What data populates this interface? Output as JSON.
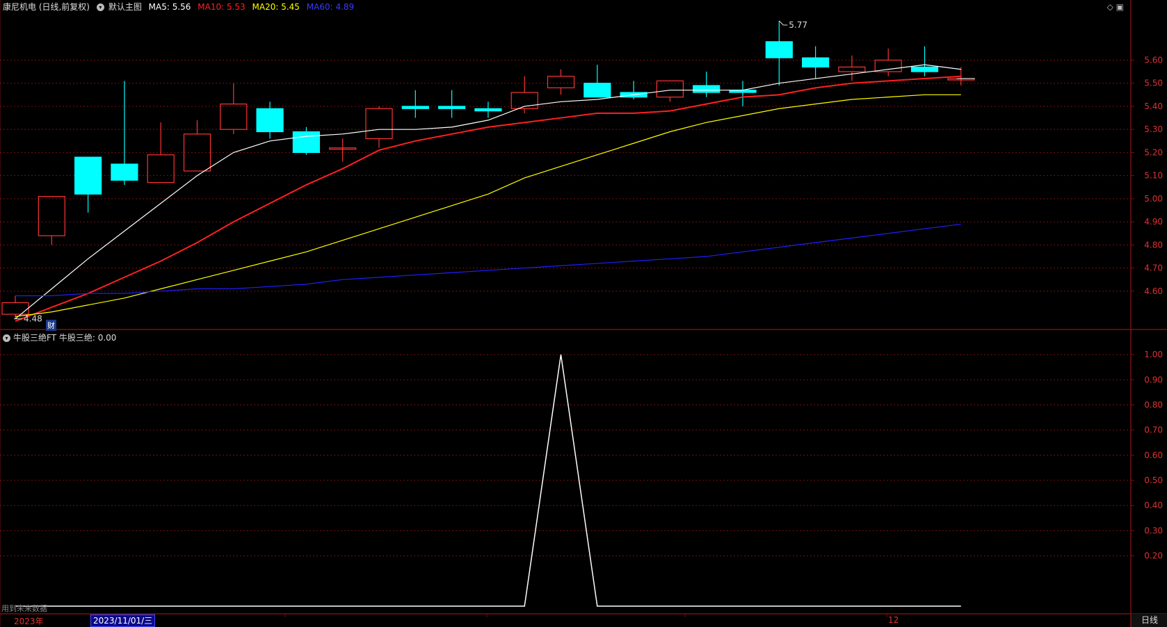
{
  "header": {
    "stock_title": "康尼机电 (日线,前复权)",
    "main_chart": "默认主图",
    "ma5": {
      "label": "MA5: 5.56",
      "color": "#ffffff"
    },
    "ma10": {
      "label": "MA10: 5.53",
      "color": "#ff2020"
    },
    "ma20": {
      "label": "MA20: 5.45",
      "color": "#ffff00"
    },
    "ma60": {
      "label": "MA60: 4.89",
      "color": "#1f1fff"
    }
  },
  "indicator": {
    "name": "牛股三绝FT",
    "value_label": "牛股三绝: 0.00",
    "future_note": "用到未来数据"
  },
  "annotations": {
    "high_label": "5.77",
    "low_label": "4.48",
    "finance_tag": "财"
  },
  "bottom": {
    "year_label": "2023年",
    "month_label": "12",
    "date_cursor": "2023/11/01/三",
    "period_button": "日线"
  },
  "colors": {
    "up": "#ff3333",
    "down": "#00ffff",
    "grid": "#7a1010",
    "axis_text": "#e03030"
  },
  "chart_data": [
    {
      "type": "candlestick",
      "ylim": [
        4.44,
        5.8
      ],
      "yticks": [
        "5.60",
        "5.50",
        "5.40",
        "5.30",
        "5.20",
        "5.10",
        "5.00",
        "4.90",
        "4.80",
        "4.70",
        "4.60"
      ],
      "candles": [
        {
          "o": 4.5,
          "h": 4.58,
          "l": 4.48,
          "c": 4.55
        },
        {
          "o": 4.84,
          "h": 5.01,
          "l": 4.8,
          "c": 5.01
        },
        {
          "o": 5.18,
          "h": 5.18,
          "l": 4.94,
          "c": 5.02
        },
        {
          "o": 5.15,
          "h": 5.51,
          "l": 5.06,
          "c": 5.08
        },
        {
          "o": 5.07,
          "h": 5.33,
          "l": 5.07,
          "c": 5.19
        },
        {
          "o": 5.12,
          "h": 5.34,
          "l": 5.12,
          "c": 5.28
        },
        {
          "o": 5.3,
          "h": 5.5,
          "l": 5.28,
          "c": 5.41
        },
        {
          "o": 5.39,
          "h": 5.42,
          "l": 5.26,
          "c": 5.29
        },
        {
          "o": 5.29,
          "h": 5.31,
          "l": 5.19,
          "c": 5.2
        },
        {
          "o": 5.22,
          "h": 5.26,
          "l": 5.16,
          "c": 5.22
        },
        {
          "o": 5.26,
          "h": 5.4,
          "l": 5.22,
          "c": 5.39
        },
        {
          "o": 5.4,
          "h": 5.47,
          "l": 5.35,
          "c": 5.39
        },
        {
          "o": 5.4,
          "h": 5.47,
          "l": 5.35,
          "c": 5.39
        },
        {
          "o": 5.39,
          "h": 5.42,
          "l": 5.35,
          "c": 5.38
        },
        {
          "o": 5.39,
          "h": 5.53,
          "l": 5.37,
          "c": 5.46
        },
        {
          "o": 5.48,
          "h": 5.56,
          "l": 5.45,
          "c": 5.53
        },
        {
          "o": 5.5,
          "h": 5.58,
          "l": 5.44,
          "c": 5.44
        },
        {
          "o": 5.46,
          "h": 5.51,
          "l": 5.43,
          "c": 5.44
        },
        {
          "o": 5.44,
          "h": 5.51,
          "l": 5.42,
          "c": 5.51
        },
        {
          "o": 5.49,
          "h": 5.55,
          "l": 5.44,
          "c": 5.46
        },
        {
          "o": 5.47,
          "h": 5.51,
          "l": 5.4,
          "c": 5.46
        },
        {
          "o": 5.68,
          "h": 5.77,
          "l": 5.49,
          "c": 5.61
        },
        {
          "o": 5.61,
          "h": 5.66,
          "l": 5.52,
          "c": 5.57
        },
        {
          "o": 5.55,
          "h": 5.62,
          "l": 5.51,
          "c": 5.57
        },
        {
          "o": 5.55,
          "h": 5.65,
          "l": 5.53,
          "c": 5.6
        },
        {
          "o": 5.57,
          "h": 5.66,
          "l": 5.53,
          "c": 5.55
        },
        {
          "o": 5.52,
          "h": 5.57,
          "l": 5.49,
          "c": 5.52
        }
      ],
      "series": [
        {
          "name": "MA5",
          "color": "#ffffff",
          "values": [
            4.48,
            4.61,
            4.74,
            4.86,
            4.98,
            5.1,
            5.2,
            5.25,
            5.27,
            5.28,
            5.3,
            5.3,
            5.31,
            5.34,
            5.4,
            5.42,
            5.43,
            5.45,
            5.47,
            5.47,
            5.47,
            5.5,
            5.52,
            5.54,
            5.56,
            5.58,
            5.56
          ]
        },
        {
          "name": "MA10",
          "color": "#ff2020",
          "values": [
            4.47,
            4.53,
            4.59,
            4.66,
            4.73,
            4.81,
            4.9,
            4.98,
            5.06,
            5.13,
            5.21,
            5.25,
            5.28,
            5.31,
            5.33,
            5.35,
            5.37,
            5.37,
            5.38,
            5.41,
            5.44,
            5.45,
            5.48,
            5.5,
            5.51,
            5.52,
            5.53
          ]
        },
        {
          "name": "MA20",
          "color": "#ffff00",
          "values": [
            4.49,
            4.51,
            4.54,
            4.57,
            4.61,
            4.65,
            4.69,
            4.73,
            4.77,
            4.82,
            4.87,
            4.92,
            4.97,
            5.02,
            5.09,
            5.14,
            5.19,
            5.24,
            5.29,
            5.33,
            5.36,
            5.39,
            5.41,
            5.43,
            5.44,
            5.45,
            5.45
          ]
        },
        {
          "name": "MA60",
          "color": "#1f1fff",
          "values": [
            4.58,
            4.58,
            4.59,
            4.59,
            4.6,
            4.61,
            4.61,
            4.62,
            4.63,
            4.65,
            4.66,
            4.67,
            4.68,
            4.69,
            4.7,
            4.71,
            4.72,
            4.73,
            4.74,
            4.75,
            4.77,
            4.79,
            4.81,
            4.83,
            4.85,
            4.87,
            4.89
          ]
        }
      ]
    },
    {
      "type": "line",
      "name": "牛股三绝",
      "ylim": [
        0,
        1.05
      ],
      "yticks": [
        "1.00",
        "0.90",
        "0.80",
        "0.70",
        "0.60",
        "0.50",
        "0.40",
        "0.30",
        "0.20"
      ],
      "values": [
        0,
        0,
        0,
        0,
        0,
        0,
        0,
        0,
        0,
        0,
        0,
        0,
        0,
        0,
        0,
        1,
        0,
        0,
        0,
        0,
        0,
        0,
        0,
        0,
        0,
        0,
        0
      ]
    }
  ]
}
